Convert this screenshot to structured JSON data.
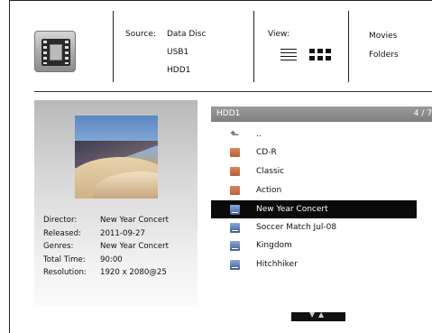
{
  "header": {
    "source_label": "Source:",
    "sources": [
      "Data Disc",
      "USB1",
      "HDD1"
    ],
    "view_label": "View:",
    "view_modes": [
      "list-view-icon",
      "grid-view-icon"
    ],
    "categories": [
      "Movies",
      "Folders"
    ]
  },
  "details": {
    "fields": [
      {
        "label": "Director:",
        "value": "New Year Concert"
      },
      {
        "label": "Released:",
        "value": "2011-09-27"
      },
      {
        "label": "Genres:",
        "value": "New Year Concert"
      },
      {
        "label": "Total Time:",
        "value": "90:00"
      },
      {
        "label": "Resolution:",
        "value": "1920 x 2080@25"
      }
    ]
  },
  "list": {
    "path": "HDD1",
    "page": "4 / 7",
    "items": [
      {
        "type": "up",
        "label": ".."
      },
      {
        "type": "folder",
        "label": "CD-R"
      },
      {
        "type": "folder",
        "label": "Classic"
      },
      {
        "type": "folder",
        "label": "Action"
      },
      {
        "type": "video",
        "label": "New Year Concert",
        "selected": true
      },
      {
        "type": "video",
        "label": "Soccer Match Jul-08"
      },
      {
        "type": "video",
        "label": "Kingdom"
      },
      {
        "type": "video",
        "label": "Hitchhiker"
      }
    ]
  },
  "colors": {
    "selected_bg": "#0a0a0a",
    "header_bar": "#8a8a8a",
    "folder": "#c86e46",
    "video": "#4e6fae"
  }
}
